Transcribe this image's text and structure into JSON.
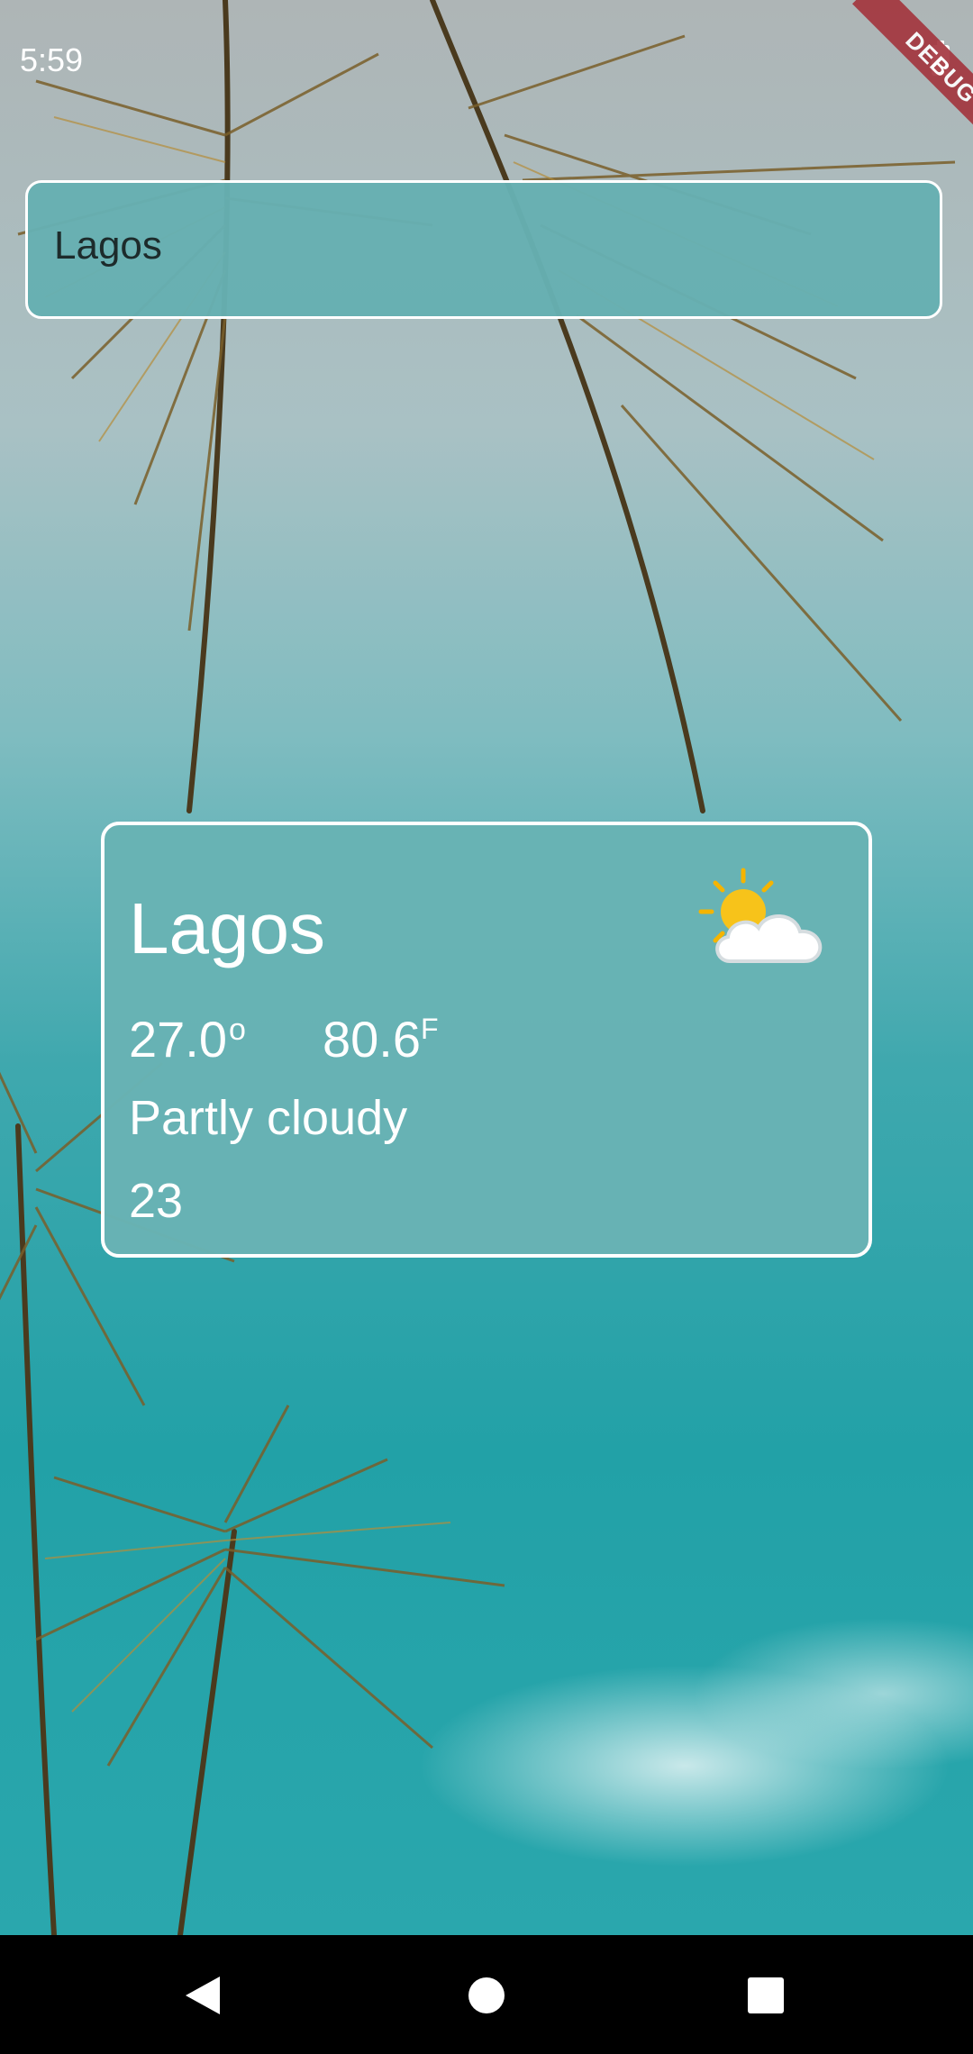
{
  "status_bar": {
    "time": "5:59",
    "debug_banner": "DEBUG"
  },
  "search": {
    "value": "Lagos"
  },
  "weather": {
    "city": "Lagos",
    "temp_c": "27.0",
    "temp_c_unit": "o",
    "temp_f": "80.6",
    "temp_f_unit": "F",
    "condition": "Partly cloudy",
    "humidity": "23",
    "icon": "partly-cloudy-icon"
  },
  "nav_bar": {
    "back_icon": "back-triangle-icon",
    "home_icon": "home-circle-icon",
    "recents_icon": "recents-square-icon"
  },
  "colors": {
    "card_bg": "#68b2b4",
    "sky_teal": "#22a1a7",
    "border": "#ffffff",
    "debug": "#a3343c"
  }
}
